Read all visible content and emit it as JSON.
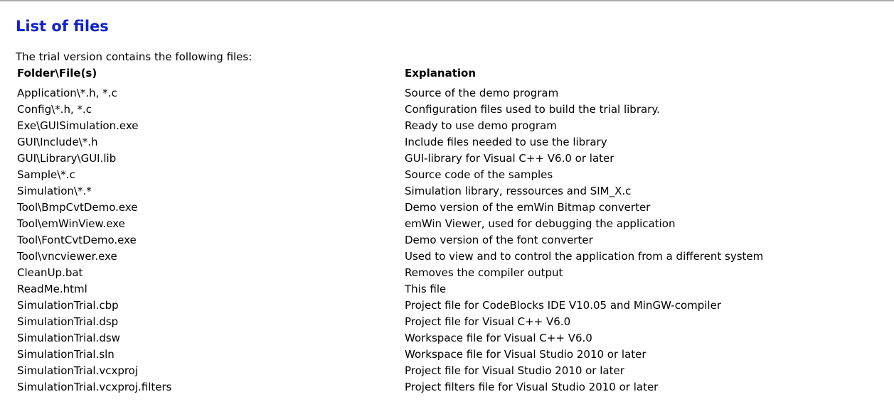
{
  "title": "List of files",
  "intro": "The trial version contains the following files:",
  "colors": {
    "heading": "#1122cc",
    "rule": "#a9a9a9"
  },
  "table": {
    "headers": [
      "Folder\\File(s)",
      "Explanation"
    ],
    "rows": [
      [
        "Application\\*.h, *.c",
        "Source of the demo program"
      ],
      [
        "Config\\*.h, *.c",
        "Configuration files used to build the trial library."
      ],
      [
        "Exe\\GUISimulation.exe",
        "Ready to use demo program"
      ],
      [
        "GUI\\Include\\*.h",
        "Include files needed to use the library"
      ],
      [
        "GUI\\Library\\GUI.lib",
        "GUI-library for Visual C++ V6.0 or later"
      ],
      [
        "Sample\\*.c",
        "Source code of the samples"
      ],
      [
        "Simulation\\*.*",
        "Simulation library, ressources and SIM_X.c"
      ],
      [
        "Tool\\BmpCvtDemo.exe",
        "Demo version of the emWin Bitmap converter"
      ],
      [
        "Tool\\emWinView.exe",
        "emWin Viewer, used for debugging the application"
      ],
      [
        "Tool\\FontCvtDemo.exe",
        "Demo version of the font converter"
      ],
      [
        "Tool\\vncviewer.exe",
        "Used to view and to control the application from a different system"
      ],
      [
        "CleanUp.bat",
        "Removes the compiler output"
      ],
      [
        "ReadMe.html",
        "This file"
      ],
      [
        "SimulationTrial.cbp",
        "Project file for CodeBlocks IDE V10.05 and MinGW-compiler"
      ],
      [
        "SimulationTrial.dsp",
        "Project file for Visual C++ V6.0"
      ],
      [
        "SimulationTrial.dsw",
        "Workspace file for Visual C++ V6.0"
      ],
      [
        "SimulationTrial.sln",
        "Workspace file for Visual Studio 2010 or later"
      ],
      [
        "SimulationTrial.vcxproj",
        "Project file for Visual Studio 2010 or later"
      ],
      [
        "SimulationTrial.vcxproj.filters",
        "Project filters file for Visual Studio 2010 or later"
      ]
    ]
  }
}
